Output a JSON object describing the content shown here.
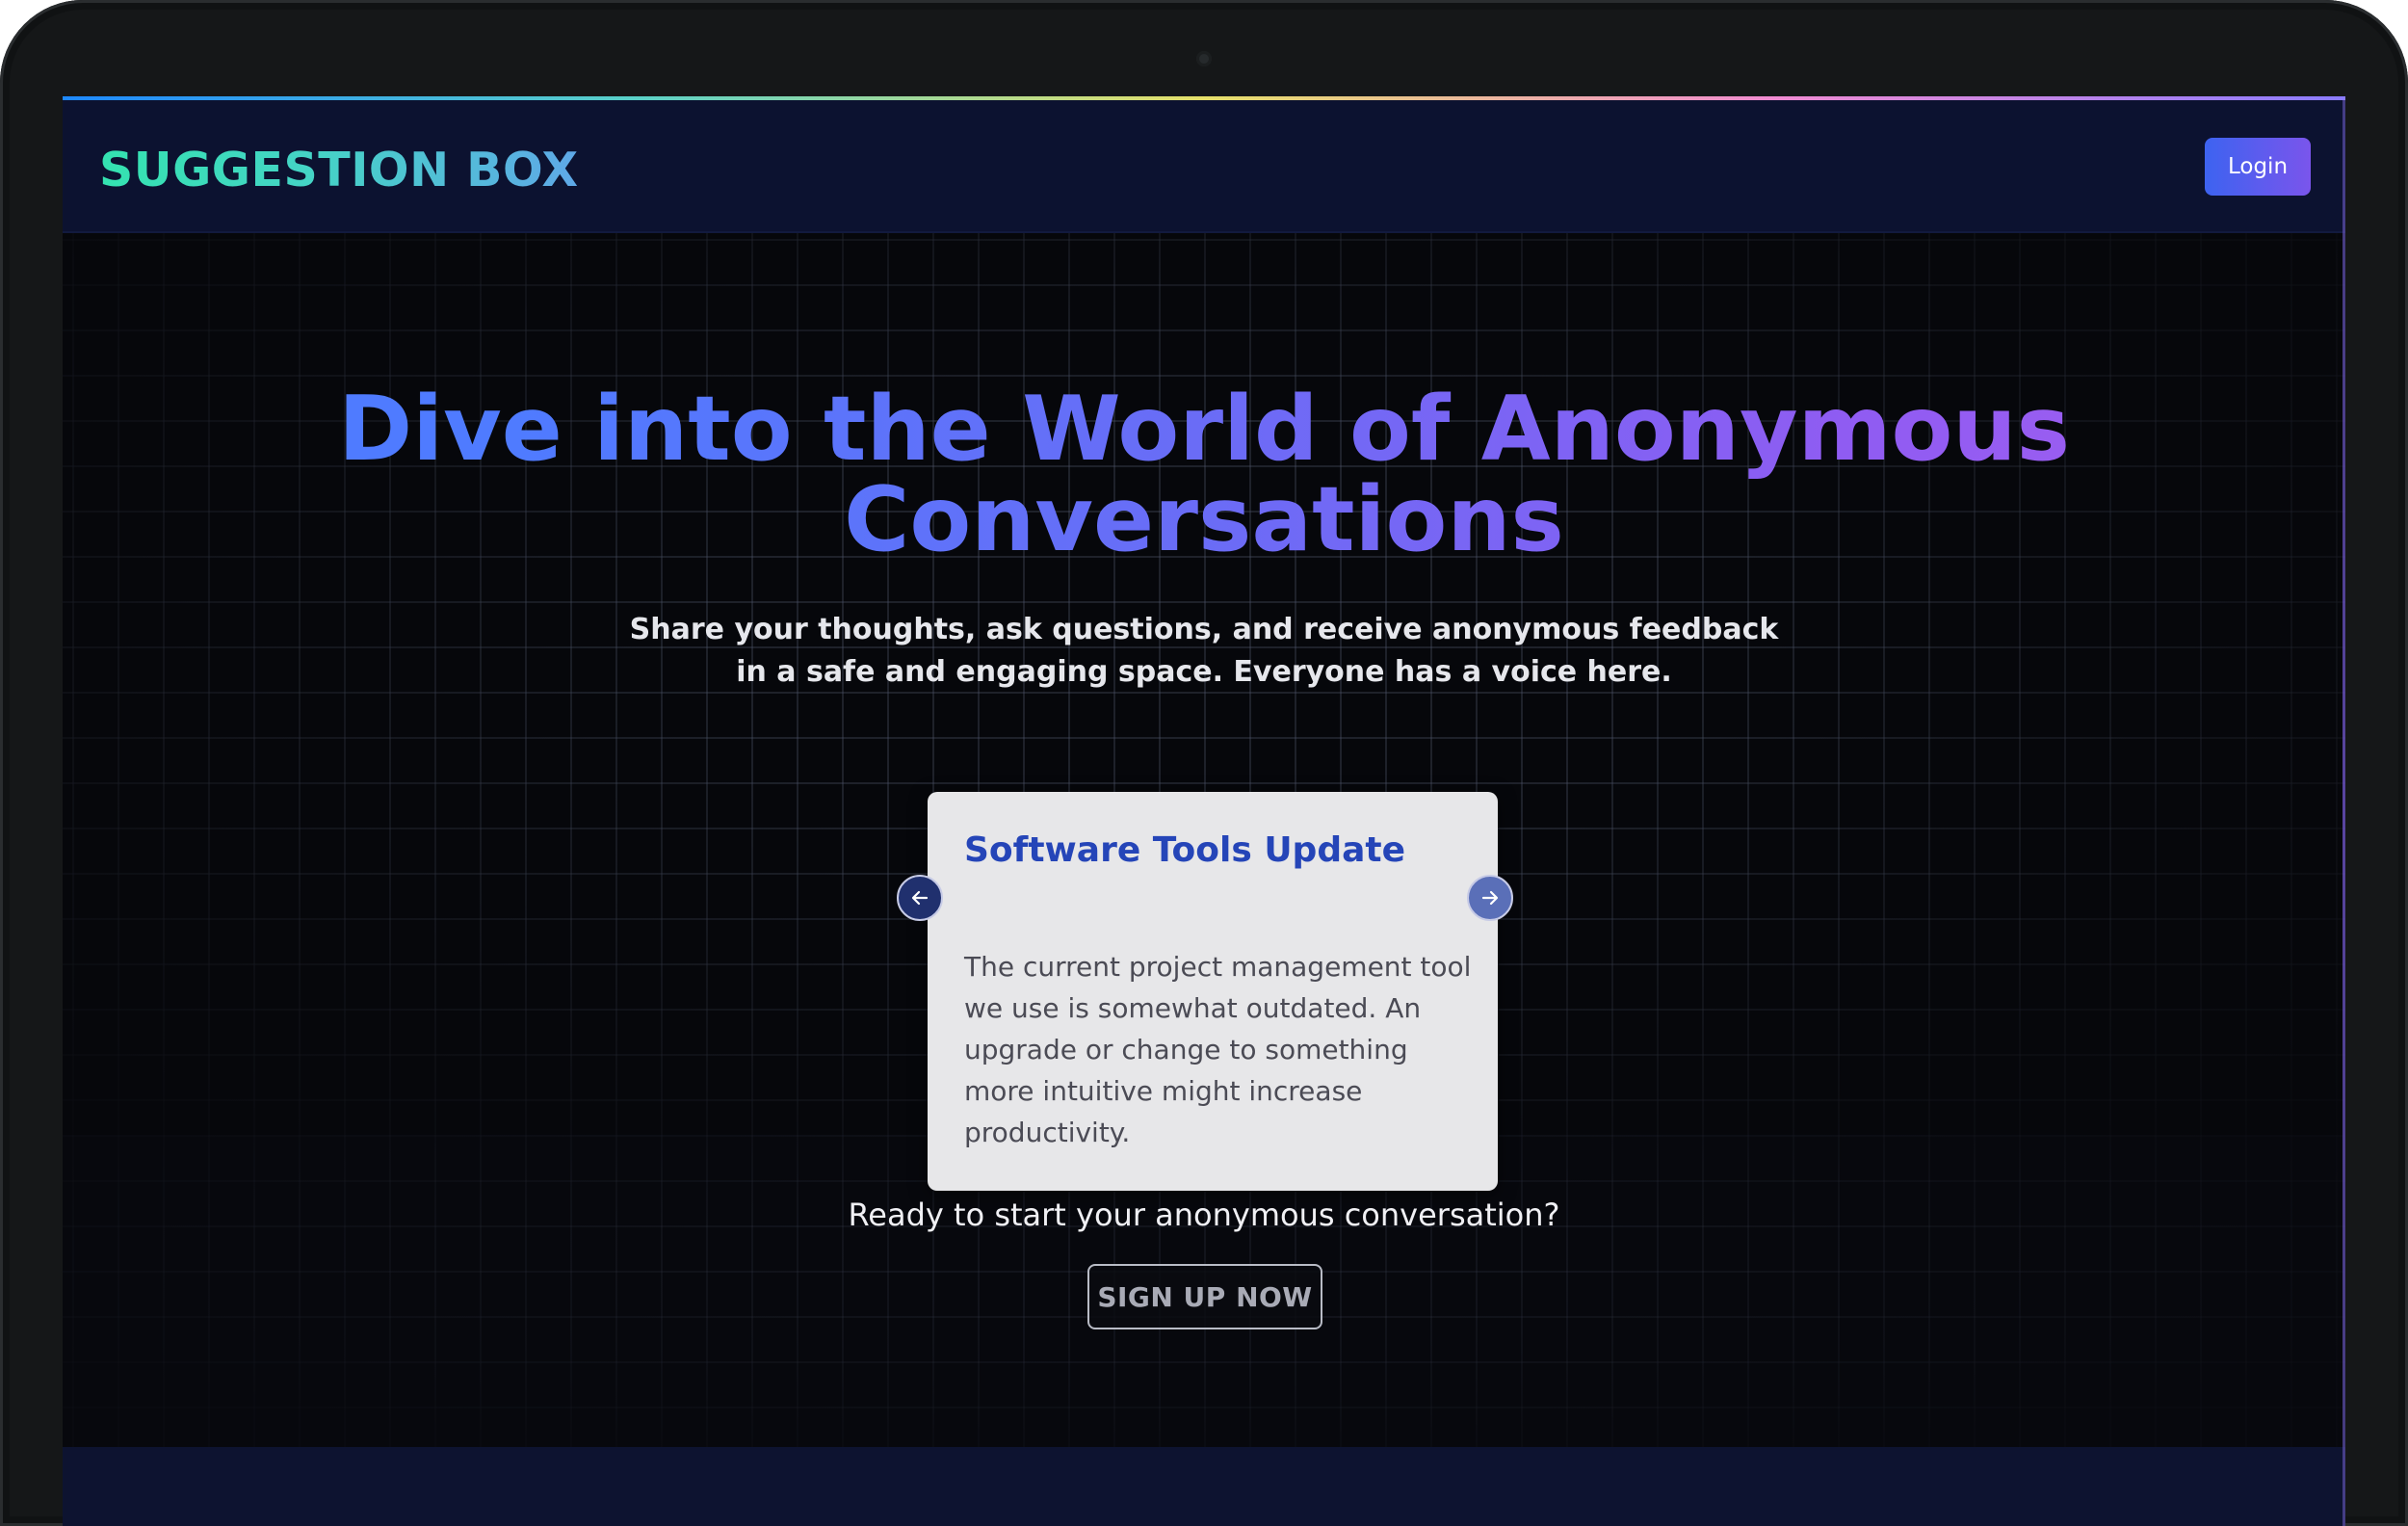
{
  "header": {
    "logo": "SUGGESTION BOX",
    "login_label": "Login"
  },
  "hero": {
    "headline_line1": "Dive into the World of Anonymous",
    "headline_line2": "Conversations",
    "subtitle": "Share your thoughts, ask questions, and receive anonymous feedback in a safe and engaging space. Everyone has a voice here."
  },
  "carousel": {
    "title": "Software Tools Update",
    "body": "The current project management tool we use is somewhat outdated. An upgrade or change to something more intuitive might increase productivity.",
    "prev_icon": "arrow-left-icon",
    "next_icon": "arrow-right-icon"
  },
  "cta": {
    "prompt": "Ready to start your anonymous conversation?",
    "signup_label": "SIGN UP NOW"
  },
  "colors": {
    "accent_start": "#3d63f0",
    "accent_end": "#7a55ec",
    "logo_green": "#34e3b0",
    "card_title": "#2545b8",
    "nav_bg": "#0c1230"
  }
}
